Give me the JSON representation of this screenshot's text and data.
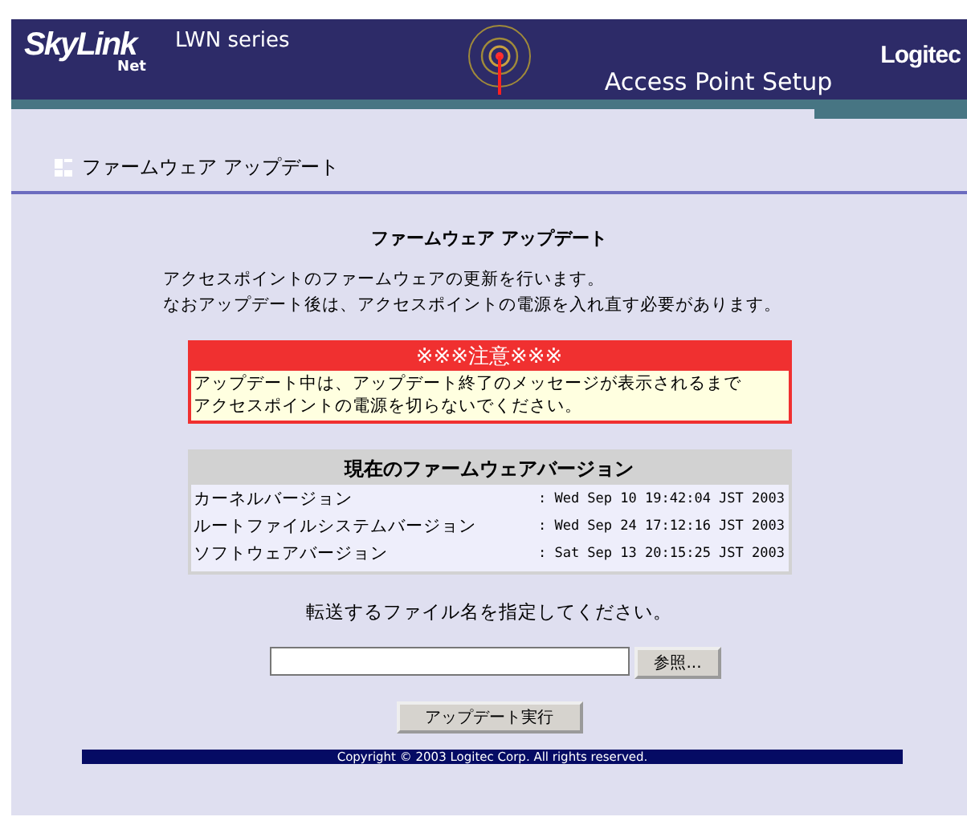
{
  "header": {
    "logo": "SkyLink",
    "logo_sub": "Net",
    "series": "LWN series",
    "title": "Access Point Setup",
    "brand": "Logitec"
  },
  "section_title": "ファームウェア アップデート",
  "heading": "ファームウェア アップデート",
  "description": [
    "アクセスポイントのファームウェアの更新を行います。",
    "なおアップデート後は、アクセスポイントの電源を入れ直す必要があります。"
  ],
  "warning": {
    "title": "※※※注意※※※",
    "lines": [
      "アップデート中は、アップデート終了のメッセージが表示されるまで",
      "アクセスポイントの電源を切らないでください。"
    ]
  },
  "versions": {
    "title": "現在のファームウェアバージョン",
    "rows": [
      {
        "label": "カーネルバージョン",
        "value": ": Wed Sep 10 19:42:04 JST 2003"
      },
      {
        "label": "ルートファイルシステムバージョン",
        "value": ": Wed Sep 24 17:12:16 JST 2003"
      },
      {
        "label": "ソフトウェアバージョン",
        "value": ": Sat Sep 13 20:15:25 JST 2003"
      }
    ]
  },
  "prompt": "転送するファイル名を指定してください。",
  "file_button": "参照...",
  "submit_button": "アップデート実行",
  "footer": "Copyright © 2003 Logitec Corp. All rights reserved."
}
